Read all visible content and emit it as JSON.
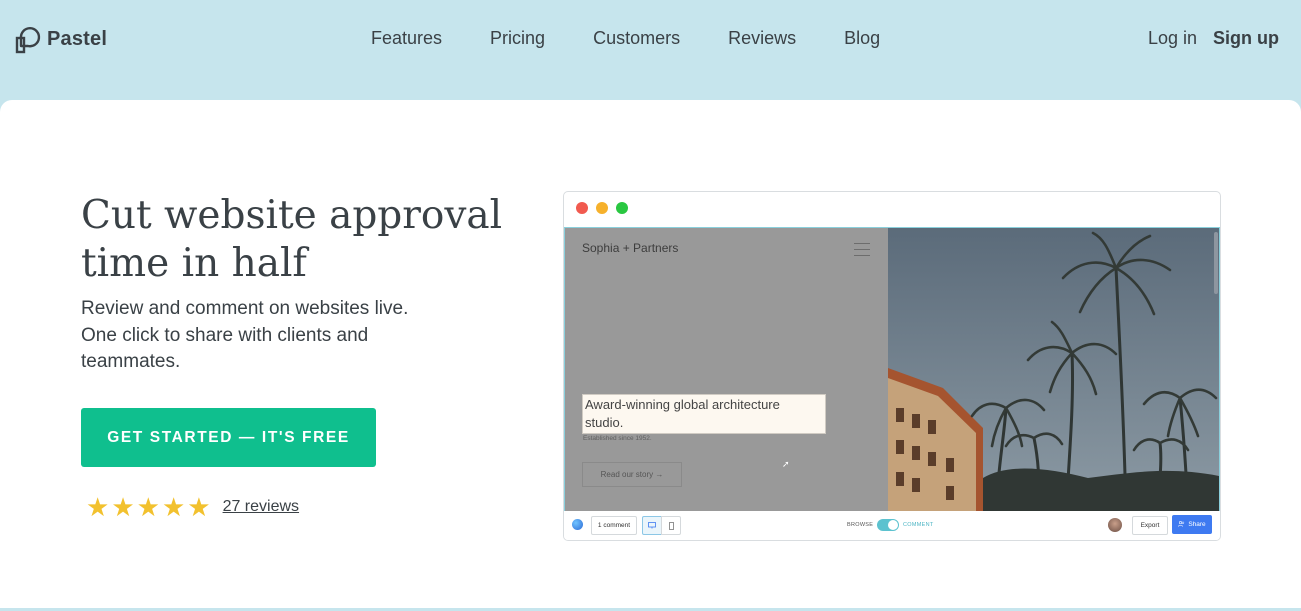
{
  "brand": {
    "name": "Pastel",
    "icon": "pastel-logo-icon"
  },
  "nav": {
    "links": [
      "Features",
      "Pricing",
      "Customers",
      "Reviews",
      "Blog"
    ],
    "login": "Log in",
    "signup": "Sign up"
  },
  "hero": {
    "headline": "Cut website approval time in half",
    "subhead": "Review and comment on websites live. One click to share with clients and teammates.",
    "cta": "GET STARTED — IT'S FREE",
    "rating": {
      "stars": 5,
      "max": 5,
      "reviews_label": "27 reviews"
    }
  },
  "mockup": {
    "site_title": "Sophia + Partners",
    "tagline": "Award-winning global architecture studio.",
    "established": "Established since 1952.",
    "story_button": "Read our story →",
    "toolbar": {
      "comments": "1 comment",
      "browse": "BROWSE",
      "comment_mode": "COMMENT",
      "export": "Export",
      "share": "Share"
    }
  },
  "colors": {
    "background": "#c6e5ed",
    "cta": "#0fbf8e",
    "star": "#f2c12e",
    "share": "#3e7af1",
    "toggle": "#5cc2cf"
  }
}
